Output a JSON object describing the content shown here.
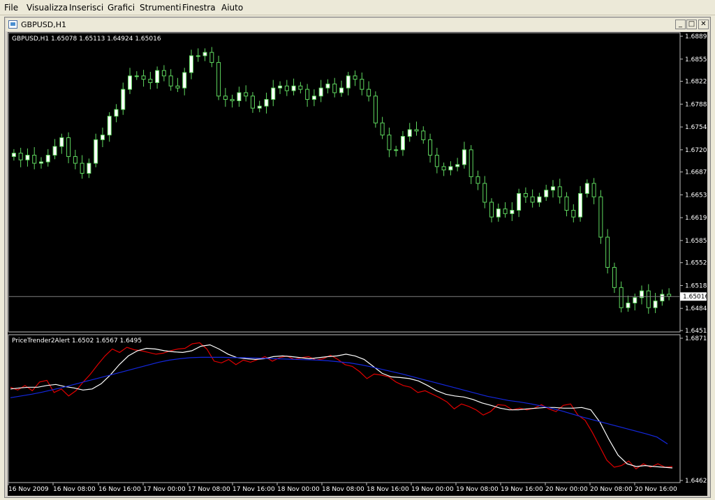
{
  "menu": {
    "items": [
      "File",
      "Visualizza",
      "Inserisci",
      "Grafici",
      "Strumenti",
      "Finestra",
      "Aiuto"
    ]
  },
  "window": {
    "title": "GBPUSD,H1",
    "minimize_glyph": "_",
    "restore_glyph": "□",
    "close_glyph": "✕"
  },
  "colors": {
    "background": "#000000",
    "candle_bull": "#ffffff",
    "candle_bear": "#000000",
    "candle_outline": "#5fd85f",
    "axis_text": "#ffffff",
    "red_line": "#e00000",
    "white_line": "#ffffff",
    "blue_line": "#1428e0",
    "price_line": "#808080"
  },
  "icons": {
    "window_icon": "chart-window-icon"
  },
  "chart_data": [
    {
      "type": "candlestick",
      "header": {
        "symbol": "GBPUSD,H1",
        "open": "1.65078",
        "high": "1.65113",
        "low": "1.64924",
        "close": "1.65016"
      },
      "current_price_label": "1.65016",
      "current_price": 1.65016,
      "ylim": [
        1.6451,
        1.6889
      ],
      "y_ticks": [
        "1.68890",
        "1.68550",
        "1.68220",
        "1.67880",
        "1.67540",
        "1.67200",
        "1.66870",
        "1.66530",
        "1.66190",
        "1.65850",
        "1.65520",
        "1.65180",
        "1.64840",
        "1.64510"
      ],
      "close": [
        1.6715,
        1.6705,
        1.6712,
        1.67,
        1.6702,
        1.6712,
        1.6725,
        1.6738,
        1.671,
        1.67,
        1.6685,
        1.67,
        1.6735,
        1.6742,
        1.677,
        1.678,
        1.681,
        1.683,
        1.683,
        1.6825,
        1.682,
        1.6838,
        1.683,
        1.6815,
        1.6812,
        1.6835,
        1.686,
        1.686,
        1.6865,
        1.685,
        1.68,
        1.6795,
        1.6793,
        1.6805,
        1.68,
        1.6782,
        1.6785,
        1.6795,
        1.6812,
        1.6815,
        1.6808,
        1.6815,
        1.681,
        1.6795,
        1.68,
        1.6812,
        1.6818,
        1.6805,
        1.6812,
        1.683,
        1.6825,
        1.681,
        1.68,
        1.676,
        1.6742,
        1.672,
        1.672,
        1.674,
        1.675,
        1.6748,
        1.6735,
        1.6712,
        1.6695,
        1.669,
        1.6695,
        1.6698,
        1.672,
        1.668,
        1.667,
        1.6642,
        1.662,
        1.6632,
        1.6625,
        1.663,
        1.6655,
        1.665,
        1.6642,
        1.665,
        1.666,
        1.6665,
        1.665,
        1.663,
        1.662,
        1.6655,
        1.667,
        1.665,
        1.659,
        1.6545,
        1.6515,
        1.6485,
        1.6492,
        1.65,
        1.651,
        1.6485,
        1.6495,
        1.6505,
        1.6502
      ],
      "x_ticks": [
        "16 Nov 2009",
        "16 Nov 08:00",
        "16 Nov 16:00",
        "17 Nov 00:00",
        "17 Nov 08:00",
        "17 Nov 16:00",
        "18 Nov 00:00",
        "18 Nov 08:00",
        "18 Nov 16:00",
        "19 Nov 00:00",
        "19 Nov 08:00",
        "19 Nov 16:00",
        "20 Nov 00:00",
        "20 Nov 08:00",
        "20 Nov 16:00"
      ]
    },
    {
      "type": "line",
      "header": {
        "name": "PriceTrender2Alert",
        "v1": "1.6502",
        "v2": "1.6567",
        "v3": "1.6495"
      },
      "ylim": [
        1.6462,
        1.6871
      ],
      "y_ticks": [
        "1.6871",
        "1.6462"
      ],
      "series": [
        {
          "color": "red",
          "values": [
            1.673,
            1.6722,
            1.6735,
            1.672,
            1.6745,
            1.675,
            1.6715,
            1.6725,
            1.6705,
            1.672,
            1.6745,
            1.6768,
            1.6795,
            1.682,
            1.684,
            1.683,
            1.6845,
            1.6838,
            1.6835,
            1.683,
            1.6825,
            1.6828,
            1.6835,
            1.684,
            1.6842,
            1.6855,
            1.6858,
            1.684,
            1.6805,
            1.68,
            1.681,
            1.6795,
            1.6808,
            1.6802,
            1.681,
            1.6818,
            1.6805,
            1.6815,
            1.682,
            1.681,
            1.6815,
            1.6818,
            1.6808,
            1.6812,
            1.6822,
            1.681,
            1.6795,
            1.679,
            1.6775,
            1.6755,
            1.6768,
            1.6765,
            1.676,
            1.6745,
            1.6735,
            1.673,
            1.6715,
            1.672,
            1.671,
            1.67,
            1.6688,
            1.6668,
            1.6682,
            1.6675,
            1.6665,
            1.665,
            1.666,
            1.668,
            1.6678,
            1.6665,
            1.667,
            1.6665,
            1.667,
            1.668,
            1.6668,
            1.666,
            1.6678,
            1.6682,
            1.665,
            1.6635,
            1.66,
            1.656,
            1.652,
            1.65,
            1.6505,
            1.6518,
            1.6495,
            1.651,
            1.65,
            1.651,
            1.65,
            1.6502
          ]
        },
        {
          "color": "white",
          "values": [
            1.6725,
            1.6728,
            1.673,
            1.673,
            1.6735,
            1.6738,
            1.6732,
            1.6728,
            1.6722,
            1.6725,
            1.674,
            1.6765,
            1.6795,
            1.682,
            1.6835,
            1.6842,
            1.684,
            1.6835,
            1.6832,
            1.683,
            1.6835,
            1.6848,
            1.6852,
            1.684,
            1.6825,
            1.6815,
            1.6812,
            1.681,
            1.6812,
            1.6818,
            1.682,
            1.6818,
            1.6815,
            1.6812,
            1.6815,
            1.6818,
            1.682,
            1.6825,
            1.682,
            1.681,
            1.679,
            1.677,
            1.676,
            1.6758,
            1.6755,
            1.6748,
            1.6735,
            1.672,
            1.671,
            1.6705,
            1.6702,
            1.6695,
            1.6685,
            1.6678,
            1.667,
            1.6665,
            1.6665,
            1.6668,
            1.667,
            1.6672,
            1.6672,
            1.667,
            1.667,
            1.6672,
            1.6665,
            1.663,
            1.658,
            1.6535,
            1.651,
            1.6502,
            1.6505,
            1.6502,
            1.65,
            1.6498
          ]
        },
        {
          "color": "blue",
          "values": [
            1.67,
            1.6705,
            1.671,
            1.6716,
            1.6723,
            1.673,
            1.6738,
            1.6746,
            1.6754,
            1.6762,
            1.677,
            1.6778,
            1.6786,
            1.6794,
            1.6802,
            1.6808,
            1.6812,
            1.6815,
            1.6816,
            1.6816,
            1.6816,
            1.6815,
            1.6815,
            1.6814,
            1.6813,
            1.6812,
            1.6811,
            1.681,
            1.6809,
            1.6808,
            1.6806,
            1.6803,
            1.68,
            1.6795,
            1.6789,
            1.6782,
            1.6775,
            1.6768,
            1.676,
            1.6752,
            1.6744,
            1.6736,
            1.6728,
            1.672,
            1.6712,
            1.6704,
            1.6698,
            1.6692,
            1.6688,
            1.6683,
            1.6677,
            1.667,
            1.6662,
            1.6653,
            1.6644,
            1.6636,
            1.6628,
            1.662,
            1.6612,
            1.6604,
            1.6596,
            1.6587,
            1.6567
          ]
        }
      ]
    }
  ]
}
